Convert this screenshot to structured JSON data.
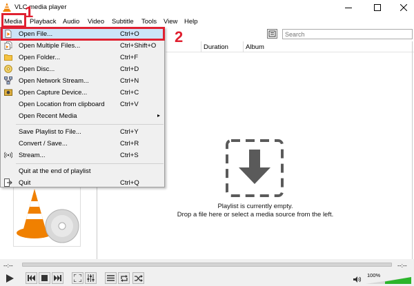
{
  "window": {
    "title": "VLC media player"
  },
  "menubar": {
    "items": [
      "Media",
      "Playback",
      "Audio",
      "Video",
      "Subtitle",
      "Tools",
      "View",
      "Help"
    ]
  },
  "media_menu": {
    "items": [
      {
        "label": "Open File...",
        "shortcut": "Ctrl+O",
        "icon": "file-icon"
      },
      {
        "label": "Open Multiple Files...",
        "shortcut": "Ctrl+Shift+O",
        "icon": "files-icon"
      },
      {
        "label": "Open Folder...",
        "shortcut": "Ctrl+F",
        "icon": "folder-icon"
      },
      {
        "label": "Open Disc...",
        "shortcut": "Ctrl+D",
        "icon": "disc-icon"
      },
      {
        "label": "Open Network Stream...",
        "shortcut": "Ctrl+N",
        "icon": "network-icon"
      },
      {
        "label": "Open Capture Device...",
        "shortcut": "Ctrl+C",
        "icon": "capture-icon"
      },
      {
        "label": "Open Location from clipboard",
        "shortcut": "Ctrl+V",
        "icon": ""
      },
      {
        "label": "Open Recent Media",
        "shortcut": "",
        "icon": ""
      },
      {
        "label": "Save Playlist to File...",
        "shortcut": "Ctrl+Y",
        "icon": ""
      },
      {
        "label": "Convert / Save...",
        "shortcut": "Ctrl+R",
        "icon": ""
      },
      {
        "label": "Stream...",
        "shortcut": "Ctrl+S",
        "icon": "stream-icon"
      },
      {
        "label": "Quit at the end of playlist",
        "shortcut": "",
        "icon": ""
      },
      {
        "label": "Quit",
        "shortcut": "Ctrl+Q",
        "icon": "quit-icon"
      }
    ],
    "submenu_arrow": "▸"
  },
  "annotations": {
    "step1": "1",
    "step2": "2"
  },
  "playlist": {
    "search_placeholder": "Search",
    "columns": [
      "Duration",
      "Album"
    ],
    "empty_line1": "Playlist is currently empty.",
    "empty_line2": "Drop a file here or select a media source from the left."
  },
  "status": {
    "elapsed": "--:--",
    "total": "--:--",
    "volume": "100%"
  },
  "colors": {
    "accent_red": "#e02030",
    "vlc_orange": "#f08000",
    "volume_green": "#2bb52b"
  }
}
